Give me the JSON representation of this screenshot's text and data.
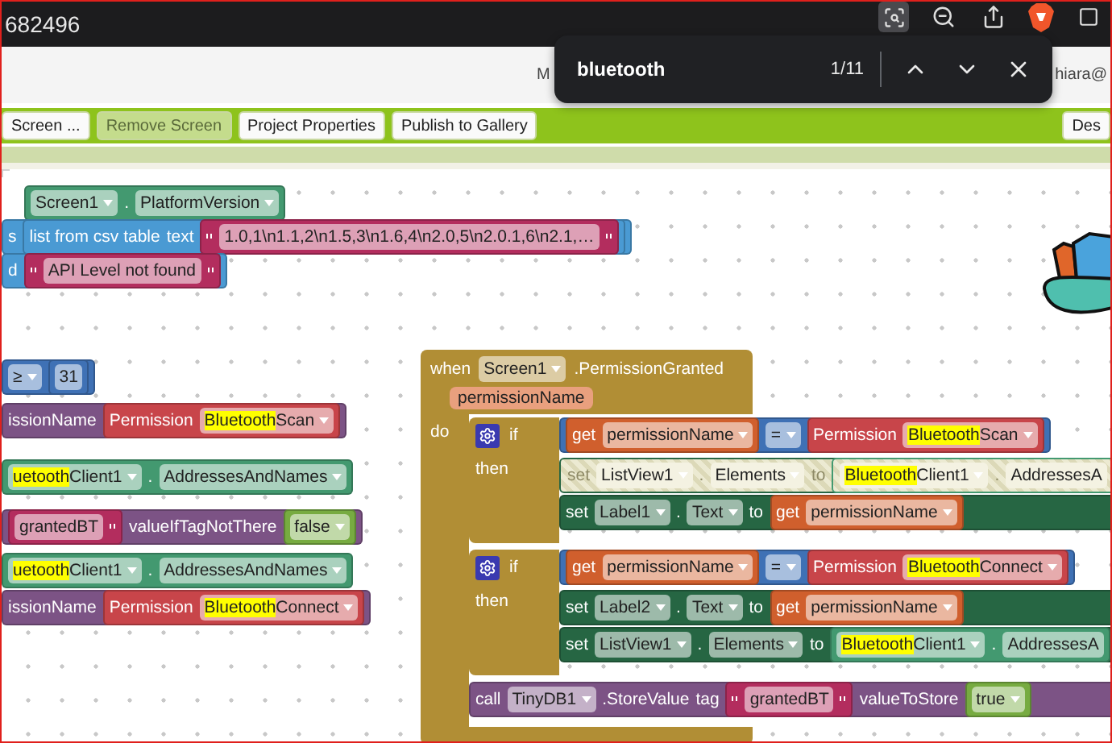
{
  "browser": {
    "url_fragment": "682496",
    "find_bar": {
      "query": "bluetooth",
      "count": "1/11"
    },
    "header_texts": [
      "M",
      "hiara@"
    ]
  },
  "toolbar": {
    "buttons": [
      {
        "label": "Screen ...",
        "disabled": false
      },
      {
        "label": "Remove Screen",
        "disabled": true
      },
      {
        "label": "Project Properties",
        "disabled": false
      },
      {
        "label": "Publish to Gallery",
        "disabled": false
      },
      {
        "label": "Des",
        "disabled": false
      }
    ]
  },
  "canvas": {
    "rows": [
      {
        "color": "#439970",
        "items": [
          {
            "kind": "field",
            "text": "Screen1"
          },
          {
            "kind": "label",
            "text": "."
          },
          {
            "kind": "field",
            "text": "PlatformVersion"
          }
        ]
      },
      {
        "color": "#4a9ad3",
        "items": [
          {
            "kind": "label",
            "text": "s"
          },
          {
            "kind": "block",
            "color": "#4a9ad3",
            "items": [
              {
                "kind": "label",
                "text": "list from csv table"
              },
              {
                "kind": "label",
                "text": "text"
              },
              {
                "kind": "block",
                "color": "#b32d5e",
                "items": [
                  {
                    "kind": "string",
                    "text": "1.0,1\\n1.1,2\\n1.5,3\\n1.6,4\\n2.0,5\\n2.0.1,6\\n2.1,…"
                  }
                ]
              }
            ]
          }
        ]
      },
      {
        "color": "#4a9ad3",
        "items": [
          {
            "kind": "label",
            "text": "d"
          },
          {
            "kind": "block",
            "color": "#b32d5e",
            "items": [
              {
                "kind": "string",
                "text": "API Level not found"
              }
            ]
          }
        ]
      },
      {
        "color": "#3f71b5",
        "items": [
          {
            "kind": "field",
            "text": "≥"
          },
          {
            "kind": "block",
            "color": "#3f71b5",
            "items": [
              {
                "kind": "input",
                "text": "31"
              }
            ]
          }
        ]
      },
      {
        "color": "#7c5385",
        "items": [
          {
            "kind": "label",
            "text": "issionName"
          },
          {
            "kind": "block",
            "color": "#c8454a",
            "items": [
              {
                "kind": "label",
                "text": "Permission"
              },
              {
                "kind": "field",
                "found": "Bluetooth",
                "text": "Scan"
              }
            ]
          }
        ]
      },
      {
        "color": "#439970",
        "items": [
          {
            "kind": "field",
            "found": "uetooth",
            "text": "Client1"
          },
          {
            "kind": "label",
            "text": "."
          },
          {
            "kind": "field",
            "text": "AddressesAndNames"
          }
        ]
      },
      {
        "color": "#7c5385",
        "items": [
          {
            "kind": "block",
            "color": "#b32d5e",
            "items": [
              {
                "kind": "input",
                "text": "grantedBT"
              },
              {
                "kind": "quote"
              }
            ]
          },
          {
            "kind": "label",
            "text": "valueIfTagNotThere"
          },
          {
            "kind": "block",
            "color": "#77ab41",
            "items": [
              {
                "kind": "field",
                "text": "false"
              }
            ]
          }
        ]
      },
      {
        "color": "#439970",
        "items": [
          {
            "kind": "field",
            "found": "uetooth",
            "text": "Client1"
          },
          {
            "kind": "label",
            "text": "."
          },
          {
            "kind": "field",
            "text": "AddressesAndNames"
          }
        ]
      },
      {
        "color": "#7c5385",
        "items": [
          {
            "kind": "label",
            "text": "issionName"
          },
          {
            "kind": "block",
            "color": "#c8454a",
            "items": [
              {
                "kind": "label",
                "text": "Permission"
              },
              {
                "kind": "field",
                "found": "Bluetooth",
                "text": "Connect"
              }
            ]
          }
        ]
      }
    ],
    "event": {
      "color": "#b18e35",
      "header": [
        {
          "kind": "label",
          "text": "when"
        },
        {
          "kind": "field",
          "text": "Screen1"
        },
        {
          "kind": "label",
          "text": ".PermissionGranted"
        }
      ],
      "parameter": "permissionName",
      "do_label": "do",
      "statements": [
        {
          "kind": "if",
          "color": "#b18e35",
          "if_label": "if",
          "then_label": "then",
          "condition": {
            "color": "#3f71b5",
            "items": [
              {
                "kind": "block",
                "color": "#d05f2d",
                "items": [
                  {
                    "kind": "label",
                    "text": "get"
                  },
                  {
                    "kind": "field",
                    "text": "permissionName"
                  }
                ]
              },
              {
                "kind": "field",
                "text": "="
              },
              {
                "kind": "block",
                "color": "#c8454a",
                "items": [
                  {
                    "kind": "label",
                    "text": "Permission"
                  },
                  {
                    "kind": "field",
                    "found": "Bluetooth",
                    "text": "Scan"
                  }
                ]
              }
            ]
          },
          "then": [
            {
              "color": "#266643",
              "disabled": true,
              "items": [
                {
                  "kind": "label",
                  "text": "set"
                },
                {
                  "kind": "field",
                  "text": "ListView1"
                },
                {
                  "kind": "label",
                  "text": "."
                },
                {
                  "kind": "field",
                  "text": "Elements"
                },
                {
                  "kind": "label",
                  "text": "to"
                },
                {
                  "kind": "block",
                  "color": "#439970",
                  "items": [
                    {
                      "kind": "field",
                      "found": "Bluetooth",
                      "text": "Client1"
                    },
                    {
                      "kind": "label",
                      "text": "."
                    },
                    {
                      "kind": "input",
                      "text": "AddressesA"
                    }
                  ]
                }
              ]
            },
            {
              "color": "#266643",
              "disabled": false,
              "items": [
                {
                  "kind": "label",
                  "text": "set"
                },
                {
                  "kind": "field",
                  "text": "Label1"
                },
                {
                  "kind": "label",
                  "text": "."
                },
                {
                  "kind": "field",
                  "text": "Text"
                },
                {
                  "kind": "label",
                  "text": "to"
                },
                {
                  "kind": "block",
                  "color": "#d05f2d",
                  "items": [
                    {
                      "kind": "label",
                      "text": "get"
                    },
                    {
                      "kind": "field",
                      "text": "permissionName"
                    }
                  ]
                }
              ]
            }
          ]
        },
        {
          "kind": "if",
          "color": "#b18e35",
          "if_label": "if",
          "then_label": "then",
          "condition": {
            "color": "#3f71b5",
            "items": [
              {
                "kind": "block",
                "color": "#d05f2d",
                "items": [
                  {
                    "kind": "label",
                    "text": "get"
                  },
                  {
                    "kind": "field",
                    "text": "permissionName"
                  }
                ]
              },
              {
                "kind": "field",
                "text": "="
              },
              {
                "kind": "block",
                "color": "#c8454a",
                "items": [
                  {
                    "kind": "label",
                    "text": "Permission"
                  },
                  {
                    "kind": "field",
                    "found": "Bluetooth",
                    "text": "Connect"
                  }
                ]
              }
            ]
          },
          "then": [
            {
              "color": "#266643",
              "disabled": false,
              "items": [
                {
                  "kind": "label",
                  "text": "set"
                },
                {
                  "kind": "field",
                  "text": "Label2"
                },
                {
                  "kind": "label",
                  "text": "."
                },
                {
                  "kind": "field",
                  "text": "Text"
                },
                {
                  "kind": "label",
                  "text": "to"
                },
                {
                  "kind": "block",
                  "color": "#d05f2d",
                  "items": [
                    {
                      "kind": "label",
                      "text": "get"
                    },
                    {
                      "kind": "field",
                      "text": "permissionName"
                    }
                  ]
                }
              ]
            },
            {
              "color": "#266643",
              "disabled": false,
              "items": [
                {
                  "kind": "label",
                  "text": "set"
                },
                {
                  "kind": "field",
                  "text": "ListView1"
                },
                {
                  "kind": "label",
                  "text": "."
                },
                {
                  "kind": "field",
                  "text": "Elements"
                },
                {
                  "kind": "label",
                  "text": "to"
                },
                {
                  "kind": "block",
                  "color": "#439970",
                  "items": [
                    {
                      "kind": "field",
                      "found": "Bluetooth",
                      "text": "Client1"
                    },
                    {
                      "kind": "label",
                      "text": "."
                    },
                    {
                      "kind": "input",
                      "text": "AddressesA"
                    }
                  ]
                }
              ]
            }
          ]
        },
        {
          "kind": "call",
          "color": "#7c5385",
          "items": [
            {
              "kind": "label",
              "text": "call"
            },
            {
              "kind": "field",
              "text": "TinyDB1"
            },
            {
              "kind": "label",
              "text": ".StoreValue"
            },
            {
              "kind": "label",
              "text": "tag"
            },
            {
              "kind": "block",
              "color": "#b32d5e",
              "items": [
                {
                  "kind": "string",
                  "text": "grantedBT"
                }
              ]
            },
            {
              "kind": "label",
              "text": "valueToStore"
            },
            {
              "kind": "block",
              "color": "#77ab41",
              "items": [
                {
                  "kind": "field",
                  "text": "true"
                }
              ]
            }
          ]
        }
      ]
    }
  }
}
